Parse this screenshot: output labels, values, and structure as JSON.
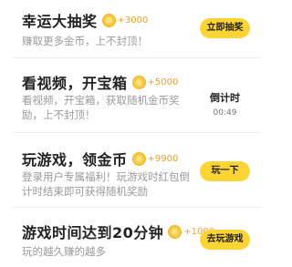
{
  "tasks": [
    {
      "title": "幸运大抽奖",
      "reward": "+3000",
      "desc_lines": [
        "赚取更多金币，上不封顶！"
      ],
      "action": "立即抽奖"
    },
    {
      "title": "看视频，开宝箱",
      "reward": "+5000",
      "desc_lines": [
        "看视频，开宝箱，获取随机金币奖",
        "励，上不封顶！"
      ],
      "countdown_label": "倒计时",
      "countdown_time": "00:49"
    },
    {
      "title": "玩游戏，领金币",
      "reward": "+9900",
      "desc_lines": [
        "登录用户专属福利！玩游戏时红包倒",
        "计时结束即可获得随机奖励"
      ],
      "action": "玩一下"
    },
    {
      "title": "游戏时间达到20分钟",
      "reward": "+1000",
      "desc_lines": [
        "玩的越久赚的越多"
      ],
      "action": "去玩游戏"
    }
  ]
}
